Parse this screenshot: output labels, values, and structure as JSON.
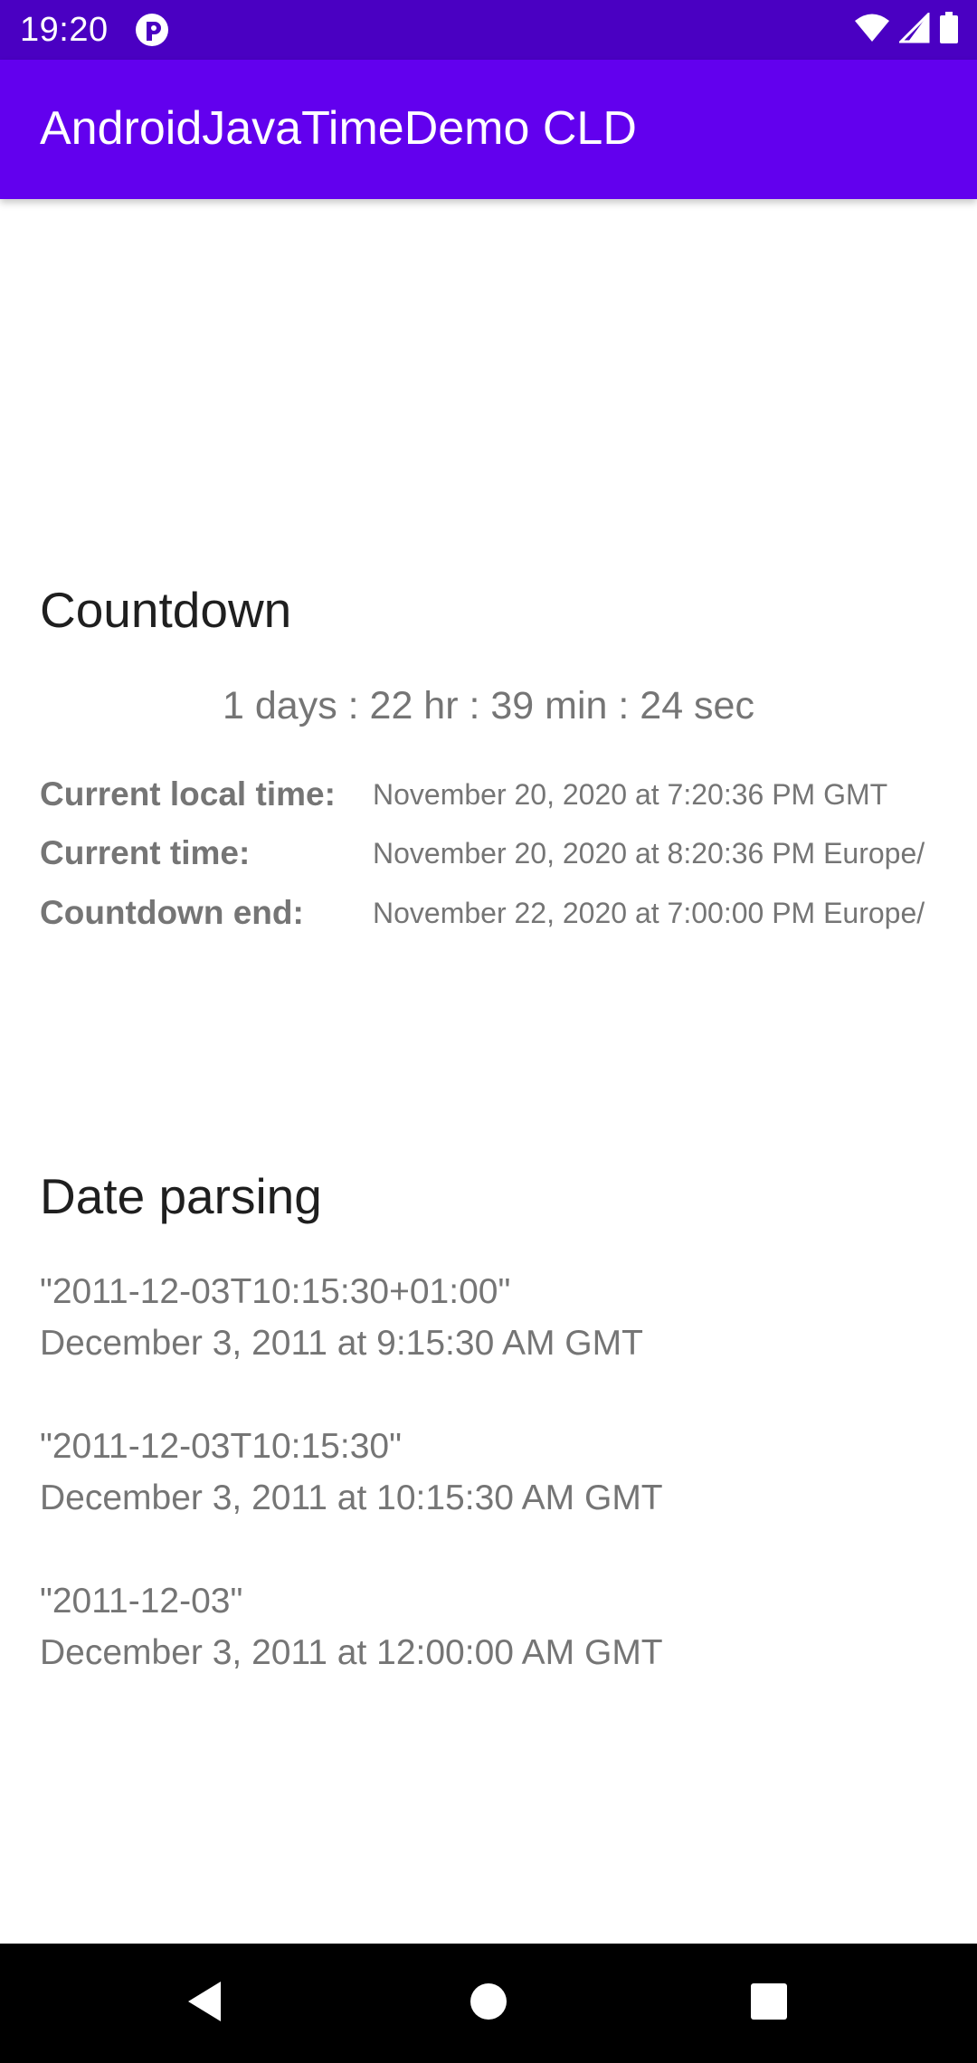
{
  "status_bar": {
    "time": "19:20",
    "icons": [
      "app-notification-icon",
      "wifi-icon",
      "cell-signal-icon",
      "battery-icon"
    ],
    "background_color": "#4a00c2"
  },
  "app_bar": {
    "title": "AndroidJavaTimeDemo CLD",
    "background_color": "#6200ee"
  },
  "countdown": {
    "title": "Countdown",
    "value": "1 days : 22 hr : 39 min : 24 sec",
    "rows": [
      {
        "label": "Current local time:",
        "value": "November 20, 2020 at 7:20:36 PM GMT"
      },
      {
        "label": "Current time:",
        "value": "November 20, 2020 at 8:20:36 PM Europe/"
      },
      {
        "label": "Countdown end:",
        "value": "November 22, 2020 at 7:00:00 PM Europe/"
      }
    ]
  },
  "date_parsing": {
    "title": "Date parsing",
    "items": [
      {
        "input": "\"2011-12-03T10:15:30+01:00\"",
        "output": "December 3, 2011 at 9:15:30 AM GMT"
      },
      {
        "input": "\"2011-12-03T10:15:30\"",
        "output": "December 3, 2011 at 10:15:30 AM GMT"
      },
      {
        "input": "\"2011-12-03\"",
        "output": "December 3, 2011 at 12:00:00 AM GMT"
      }
    ]
  },
  "nav_bar": {
    "buttons": [
      "back-icon",
      "home-icon",
      "recents-icon"
    ]
  }
}
